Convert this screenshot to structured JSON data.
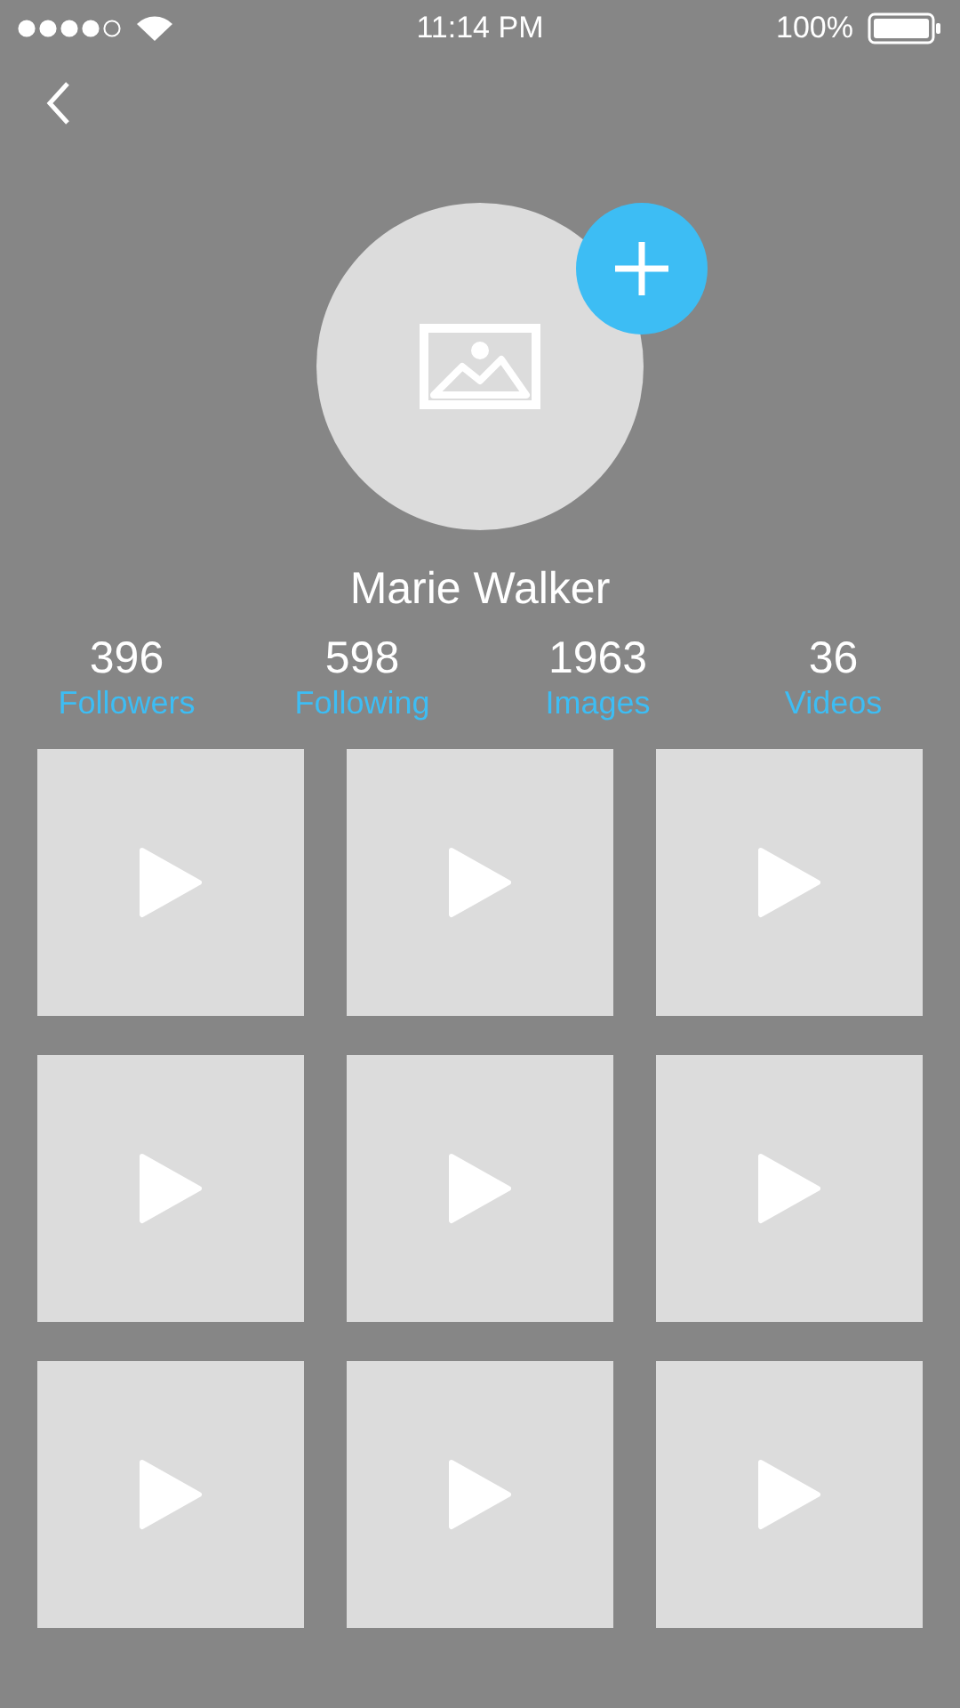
{
  "status_bar": {
    "time": "11:14 PM",
    "battery": "100%"
  },
  "profile": {
    "name": "Marie Walker"
  },
  "stats": [
    {
      "value": "396",
      "label": "Followers"
    },
    {
      "value": "598",
      "label": "Following"
    },
    {
      "value": "1963",
      "label": "Images"
    },
    {
      "value": "36",
      "label": "Videos"
    }
  ],
  "media": [
    {
      "kind": "video"
    },
    {
      "kind": "video"
    },
    {
      "kind": "video"
    },
    {
      "kind": "video"
    },
    {
      "kind": "video"
    },
    {
      "kind": "video"
    },
    {
      "kind": "video"
    },
    {
      "kind": "video"
    },
    {
      "kind": "video"
    }
  ]
}
